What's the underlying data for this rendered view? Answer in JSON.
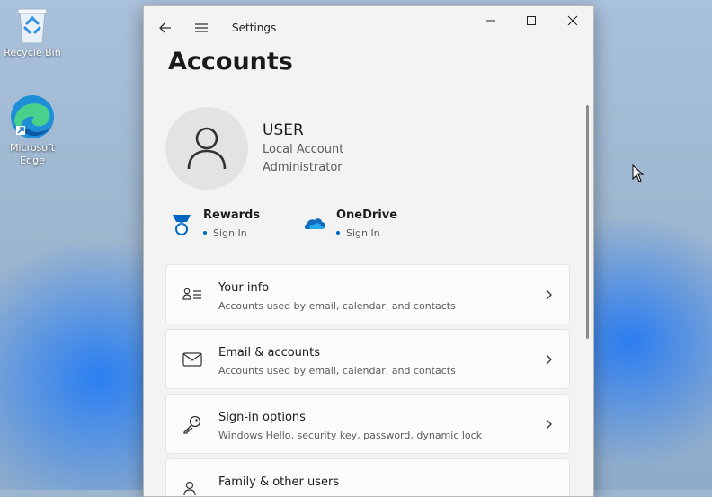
{
  "desktop": {
    "icons": [
      {
        "label": "Recycle Bin"
      },
      {
        "label": "Microsoft Edge"
      }
    ]
  },
  "window": {
    "app_title": "Settings",
    "page_title": "Accounts",
    "user": {
      "name": "USER",
      "account_type": "Local Account",
      "role": "Administrator"
    },
    "services": [
      {
        "name": "Rewards",
        "status": "Sign In",
        "icon": "rewards-medal-icon",
        "color": "#0067c0"
      },
      {
        "name": "OneDrive",
        "status": "Sign In",
        "icon": "onedrive-cloud-icon",
        "color": "#0f6cbd"
      }
    ],
    "settings": [
      {
        "title": "Your info",
        "description": "Accounts used by email, calendar, and contacts",
        "icon": "contact-card-icon"
      },
      {
        "title": "Email & accounts",
        "description": "Accounts used by email, calendar, and contacts",
        "icon": "mail-icon"
      },
      {
        "title": "Sign-in options",
        "description": "Windows Hello, security key, password, dynamic lock",
        "icon": "key-icon"
      },
      {
        "title": "Family & other users",
        "description": "",
        "icon": "people-icon"
      }
    ]
  }
}
